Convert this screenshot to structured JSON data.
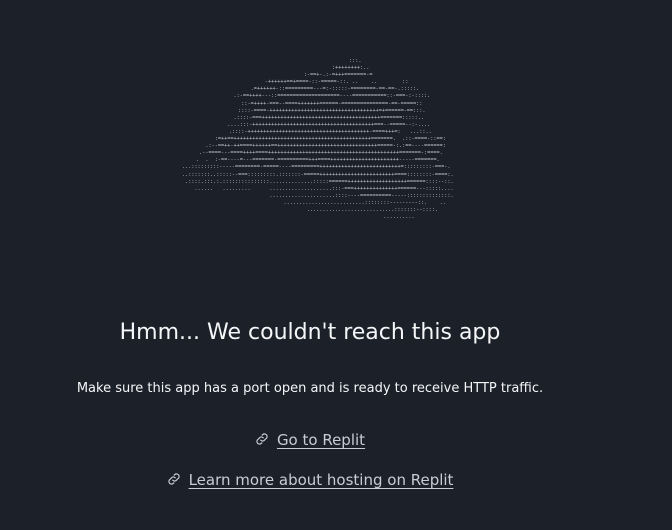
{
  "illustration": {
    "icon": "ascii-cloud-illustration",
    "ascii": "                             :::.\n                          :++++++++:..\n                  :-==+-.:-=+++=======-=\n                 -++++++==+====-::-=====-::. ..    ..        ::\n                .=++++++-::=========---=:-:::::-========-==-==-.:::::.\n              .:-==++++---::====================----===========::-===-:-::::.\n              ::-=++++-===--====+++++++======-===============-==-=====::\n              ::::-====-+++++++++++++++++++++++++++++++++++=+======-==:::.\n            .::::-===++++++++++++++++++++++++++++++++++++++=======:::::..\n            ....:::-+++++++++++++++++++++++++++++++++++++++===--=====--:-....\n             .::::-+++++++++++++++++++++++++++++++++++++++-====+++=:   ...::..\n             :=++==++++++++++++++++++++++++++++++++++++++++++++=======.  .::-====-::==:\n          .:--==++-++====++++++==++++++++++++++++++++++++++++++++=====-:.:==----======:\n       .--====---====++++====++++++++++++++++++++++++++++++++++++++++++=======-:====.\n     .  .  :-==----=---=======-==========+++====++++++++++++++++++++++-----=======.\n    ...:::::::::-----========-=====----=========++++++++++++++++++++++++++=:::::::::-===-.\n     ..:::::::..:::::--===:::::::::.:::::::-=====++++++++++++++++++++++++====::::::::-====:.\n      .::::.:::.:.:::::::::::::::..............:::::======+++++++++++++++++++======::::--::.\n         ......   .........      ....................:::-===++++++++++++++======---:::::....\n                                 .....................::::----==========-----::::::::::::::.\n                                   ..........................::::::::---------::.    ..\n                                        ............................:::::::--::::.\n                                                         .........."
  },
  "headline": "Hmm... We couldn't reach this app",
  "subtext": "Make sure this app has a port open and is ready to receive HTTP traffic.",
  "links": {
    "replit": {
      "icon": "link-icon",
      "label": "Go to Replit"
    },
    "hosting": {
      "icon": "link-icon",
      "label": "Learn more about hosting on Replit"
    }
  },
  "colors": {
    "background": "#1c2029",
    "text": "#f5f6f8",
    "link": "#c9ccd4"
  }
}
